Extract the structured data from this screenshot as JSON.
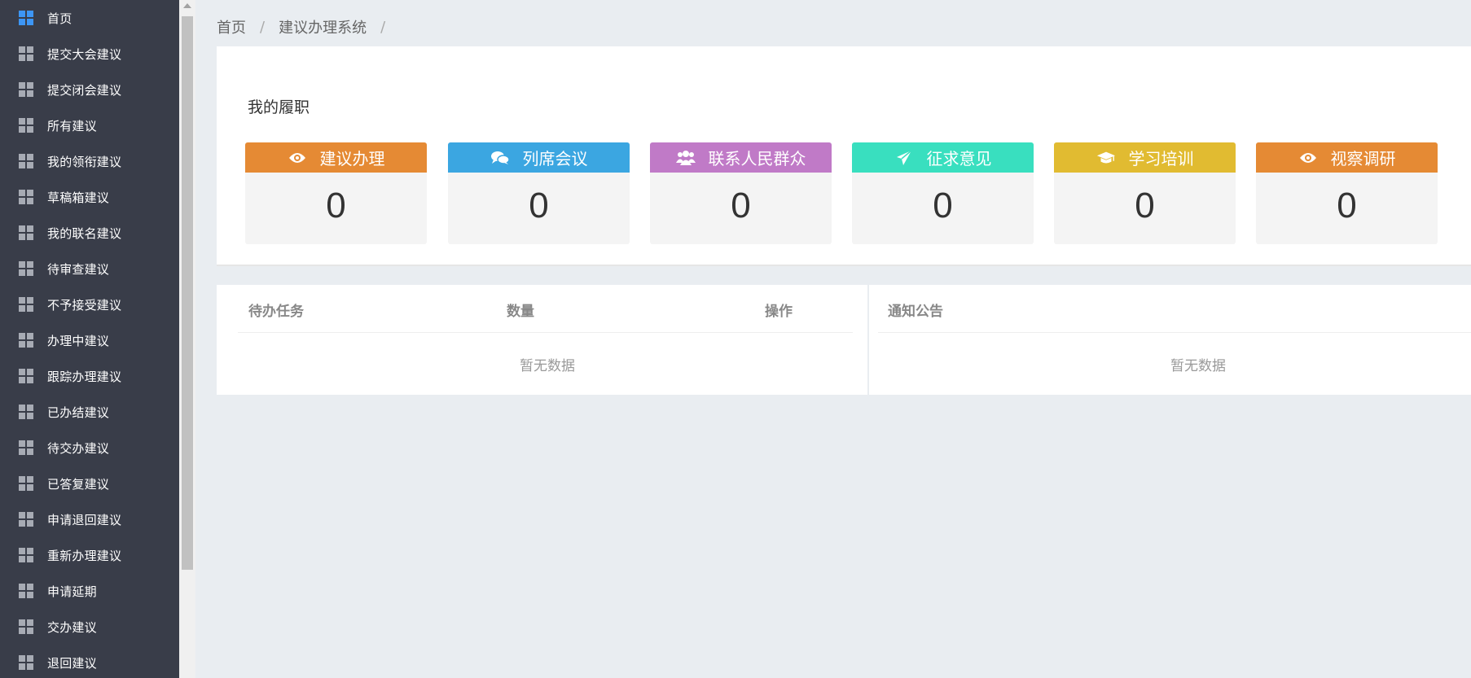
{
  "sidebar": {
    "items": [
      {
        "label": "首页",
        "active": true
      },
      {
        "label": "提交大会建议"
      },
      {
        "label": "提交闭会建议"
      },
      {
        "label": "所有建议"
      },
      {
        "label": "我的领衔建议"
      },
      {
        "label": "草稿箱建议"
      },
      {
        "label": "我的联名建议"
      },
      {
        "label": "待审查建议"
      },
      {
        "label": "不予接受建议"
      },
      {
        "label": "办理中建议"
      },
      {
        "label": "跟踪办理建议"
      },
      {
        "label": "已办结建议"
      },
      {
        "label": "待交办建议"
      },
      {
        "label": "已答复建议"
      },
      {
        "label": "申请退回建议"
      },
      {
        "label": "重新办理建议"
      },
      {
        "label": "申请延期"
      },
      {
        "label": "交办建议"
      },
      {
        "label": "退回建议"
      }
    ]
  },
  "breadcrumb": {
    "items": [
      "首页",
      "建议办理系统"
    ],
    "separator": "/"
  },
  "duties": {
    "title": "我的履职",
    "stats": [
      {
        "label": "建议办理",
        "value": "0",
        "color": "#e58a34",
        "icon": "eye-icon"
      },
      {
        "label": "列席会议",
        "value": "0",
        "color": "#3ba6e1",
        "icon": "comments-icon"
      },
      {
        "label": "联系人民群众",
        "value": "0",
        "color": "#c07ac7",
        "icon": "users-icon"
      },
      {
        "label": "征求意见",
        "value": "0",
        "color": "#39dfbf",
        "icon": "paper-plane-icon"
      },
      {
        "label": "学习培训",
        "value": "0",
        "color": "#e1bb31",
        "icon": "graduation-cap-icon"
      },
      {
        "label": "视察调研",
        "value": "0",
        "color": "#e58a34",
        "icon": "eye-icon"
      }
    ]
  },
  "tasks": {
    "col_task": "待办任务",
    "col_count": "数量",
    "col_action": "操作",
    "empty_text": "暂无数据"
  },
  "notices": {
    "title": "通知公告",
    "empty_text": "暂无数据"
  }
}
